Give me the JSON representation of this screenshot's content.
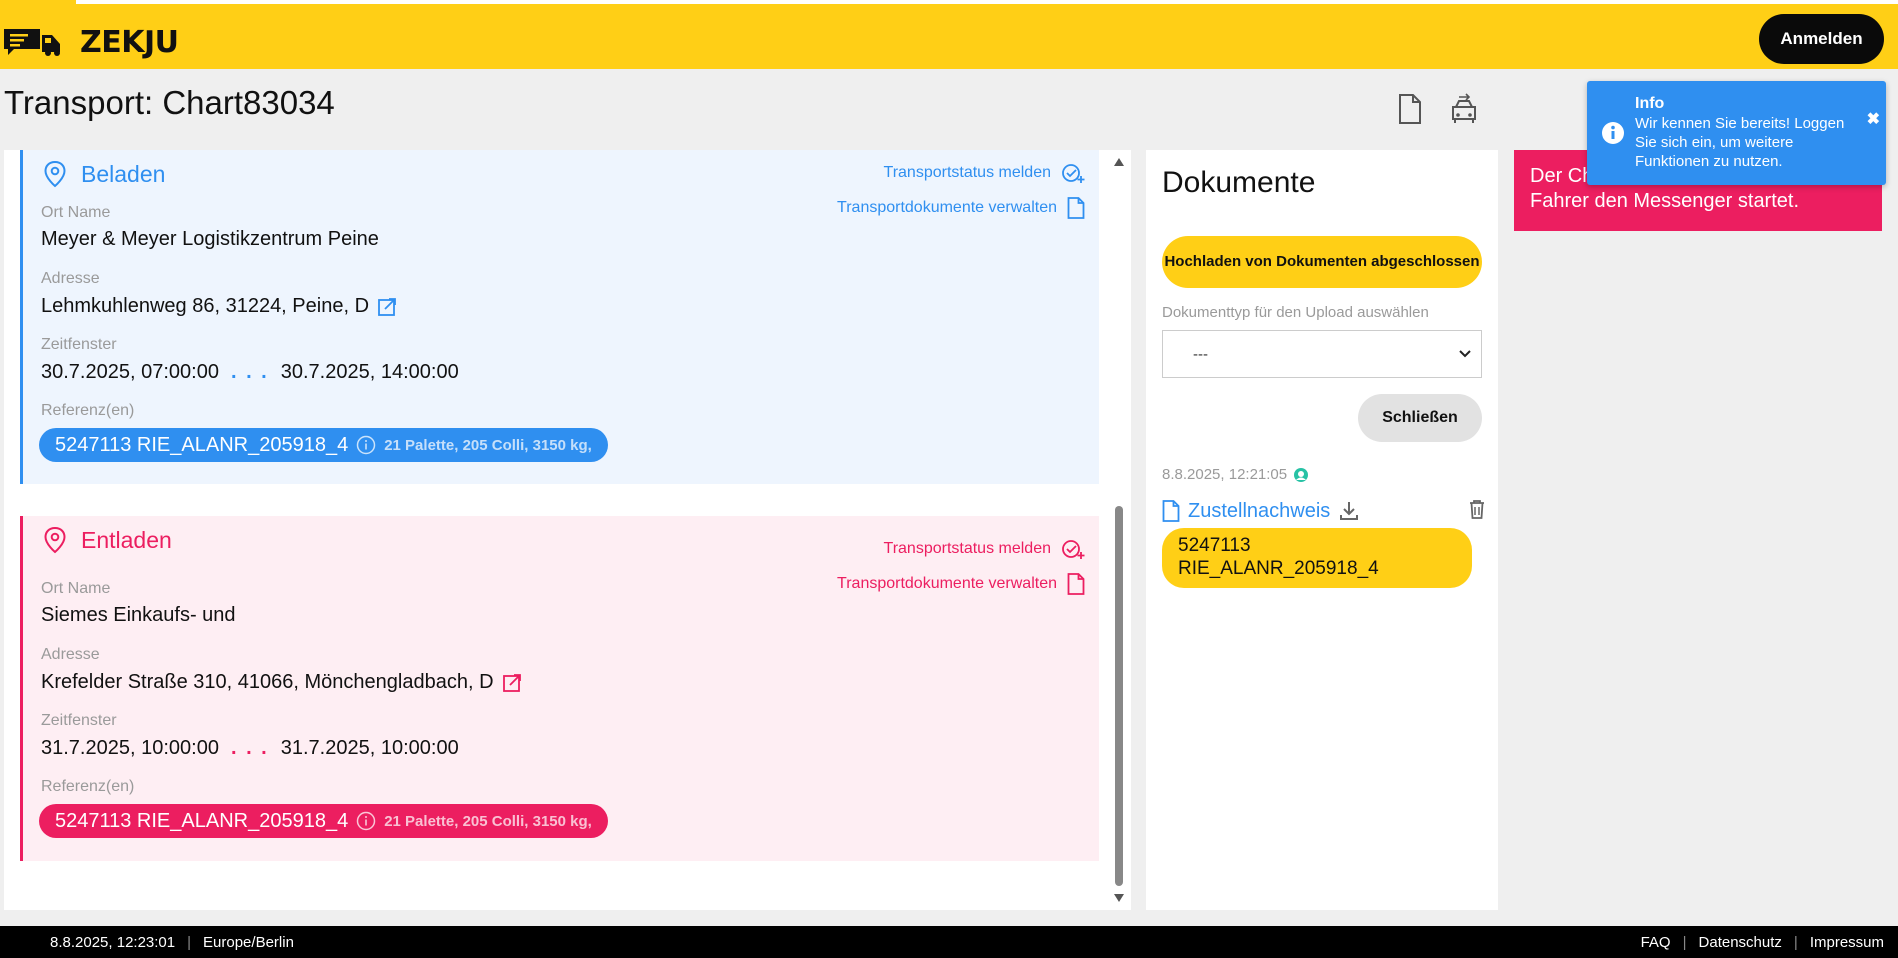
{
  "colors": {
    "brand_yellow": "#ffcf16",
    "load_blue": "#2f8ff0",
    "unload_red": "#ec1e60",
    "toast_blue": "#2f8ff0"
  },
  "header": {
    "logo_text": "ZEKJU",
    "login_label": "Anmelden"
  },
  "page": {
    "title": "Transport: Chart83034",
    "icons": [
      "document-icon",
      "truck-icon"
    ]
  },
  "stops": [
    {
      "kind": "load",
      "title": "Beladen",
      "status_action": "Transportstatus melden",
      "docs_action": "Transportdokumente verwalten",
      "location_label": "Ort Name",
      "location": "Meyer & Meyer Logistikzentrum Peine",
      "address_label": "Adresse",
      "address": "Lehmkuhlenweg 86, 31224, Peine, D",
      "window_label": "Zeitfenster",
      "window_from": "30.7.2025, 07:00:00",
      "window_sep": ". . .",
      "window_to": "30.7.2025, 14:00:00",
      "refs_label": "Referenz(en)",
      "ref": "5247113 RIE_ALANR_205918_4",
      "ref_meta": "21 Palette, 205 Colli, 3150 kg,"
    },
    {
      "kind": "unload",
      "title": "Entladen",
      "status_action": "Transportstatus melden",
      "docs_action": "Transportdokumente verwalten",
      "location_label": "Ort Name",
      "location": "Siemes Einkaufs- und",
      "address_label": "Adresse",
      "address": "Krefelder Straße 310, 41066, Mönchengladbach, D",
      "window_label": "Zeitfenster",
      "window_from": "31.7.2025, 10:00:00",
      "window_sep": ". . .",
      "window_to": "31.7.2025, 10:00:00",
      "refs_label": "Referenz(en)",
      "ref": "5247113 RIE_ALANR_205918_4",
      "ref_meta": "21 Palette, 205 Colli, 3150 kg,"
    }
  ],
  "documents": {
    "title": "Dokumente",
    "upload_done_label": "Hochladen von Dokumenten abgeschlossen",
    "doctype_label": "Dokumenttyp für den Upload auswählen",
    "doctype_value": "---",
    "close_label": "Schließen",
    "items": [
      {
        "timestamp": "8.8.2025, 12:21:05",
        "name": "Zustellnachweis",
        "ref": "5247113 RIE_ALANR_205918_4"
      }
    ]
  },
  "chat_banner": {
    "line1": "Der Ch",
    "line2": "Fahrer den Messenger startet."
  },
  "toast": {
    "title": "Info",
    "message": "Wir kennen Sie bereits! Loggen Sie sich ein, um weitere Funktionen zu nutzen.",
    "close": "✖"
  },
  "footer": {
    "datetime": "8.8.2025, 12:23:01",
    "timezone": "Europe/Berlin",
    "links": [
      "FAQ",
      "Datenschutz",
      "Impressum"
    ],
    "separator": "|"
  }
}
